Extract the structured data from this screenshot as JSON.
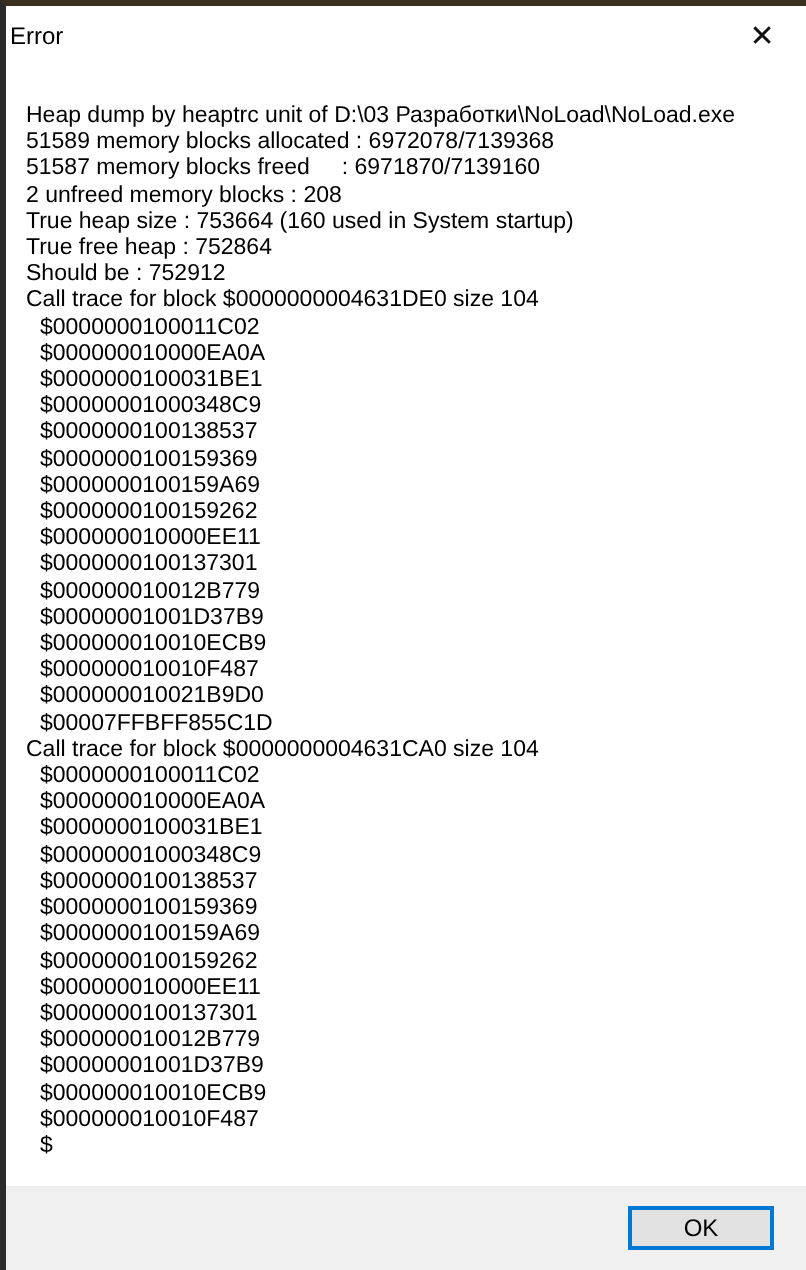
{
  "window": {
    "title": "Error",
    "close": "✕"
  },
  "message": [
    {
      "kind": "text",
      "text": "Heap dump by heaptrc unit of D:\\03 Разработки\\NoLoad\\NoLoad.exe"
    },
    {
      "kind": "text",
      "text": "51589 memory blocks allocated : 6972078/7139368"
    },
    {
      "kind": "text",
      "text": "51587 memory blocks freed     : 6971870/7139160"
    },
    {
      "kind": "text",
      "text": "2 unfreed memory blocks : 208"
    },
    {
      "kind": "text",
      "text": "True heap size : 753664 (160 used in System startup)"
    },
    {
      "kind": "text",
      "text": "True free heap : 752864"
    },
    {
      "kind": "text",
      "text": "Should be : 752912"
    },
    {
      "kind": "text",
      "text": "Call trace for block $0000000004631DE0 size 104"
    },
    {
      "kind": "address",
      "text": "$0000000100011C02"
    },
    {
      "kind": "address",
      "text": "$000000010000EA0A"
    },
    {
      "kind": "address",
      "text": "$0000000100031BE1"
    },
    {
      "kind": "address",
      "text": "$00000001000348C9"
    },
    {
      "kind": "address",
      "text": "$0000000100138537"
    },
    {
      "kind": "address",
      "text": "$0000000100159369"
    },
    {
      "kind": "address",
      "text": "$0000000100159A69"
    },
    {
      "kind": "address",
      "text": "$0000000100159262"
    },
    {
      "kind": "address",
      "text": "$000000010000EE11"
    },
    {
      "kind": "address",
      "text": "$0000000100137301"
    },
    {
      "kind": "address",
      "text": "$000000010012B779"
    },
    {
      "kind": "address",
      "text": "$00000001001D37B9"
    },
    {
      "kind": "address",
      "text": "$000000010010ECB9"
    },
    {
      "kind": "address",
      "text": "$000000010010F487"
    },
    {
      "kind": "address",
      "text": "$000000010021B9D0"
    },
    {
      "kind": "address",
      "text": "$00007FFBFF855C1D"
    },
    {
      "kind": "text",
      "text": "Call trace for block $0000000004631CA0 size 104"
    },
    {
      "kind": "address",
      "text": "$0000000100011C02"
    },
    {
      "kind": "address",
      "text": "$000000010000EA0A"
    },
    {
      "kind": "address",
      "text": "$0000000100031BE1"
    },
    {
      "kind": "address",
      "text": "$00000001000348C9"
    },
    {
      "kind": "address",
      "text": "$0000000100138537"
    },
    {
      "kind": "address",
      "text": "$0000000100159369"
    },
    {
      "kind": "address",
      "text": "$0000000100159A69"
    },
    {
      "kind": "address",
      "text": "$0000000100159262"
    },
    {
      "kind": "address",
      "text": "$000000010000EE11"
    },
    {
      "kind": "address",
      "text": "$0000000100137301"
    },
    {
      "kind": "address",
      "text": "$000000010012B779"
    },
    {
      "kind": "address",
      "text": "$00000001001D37B9"
    },
    {
      "kind": "address",
      "text": "$000000010010ECB9"
    },
    {
      "kind": "address",
      "text": "$000000010010F487"
    },
    {
      "kind": "address",
      "text": "$"
    }
  ],
  "buttons": [
    {
      "label": "OK",
      "selected": true
    }
  ]
}
